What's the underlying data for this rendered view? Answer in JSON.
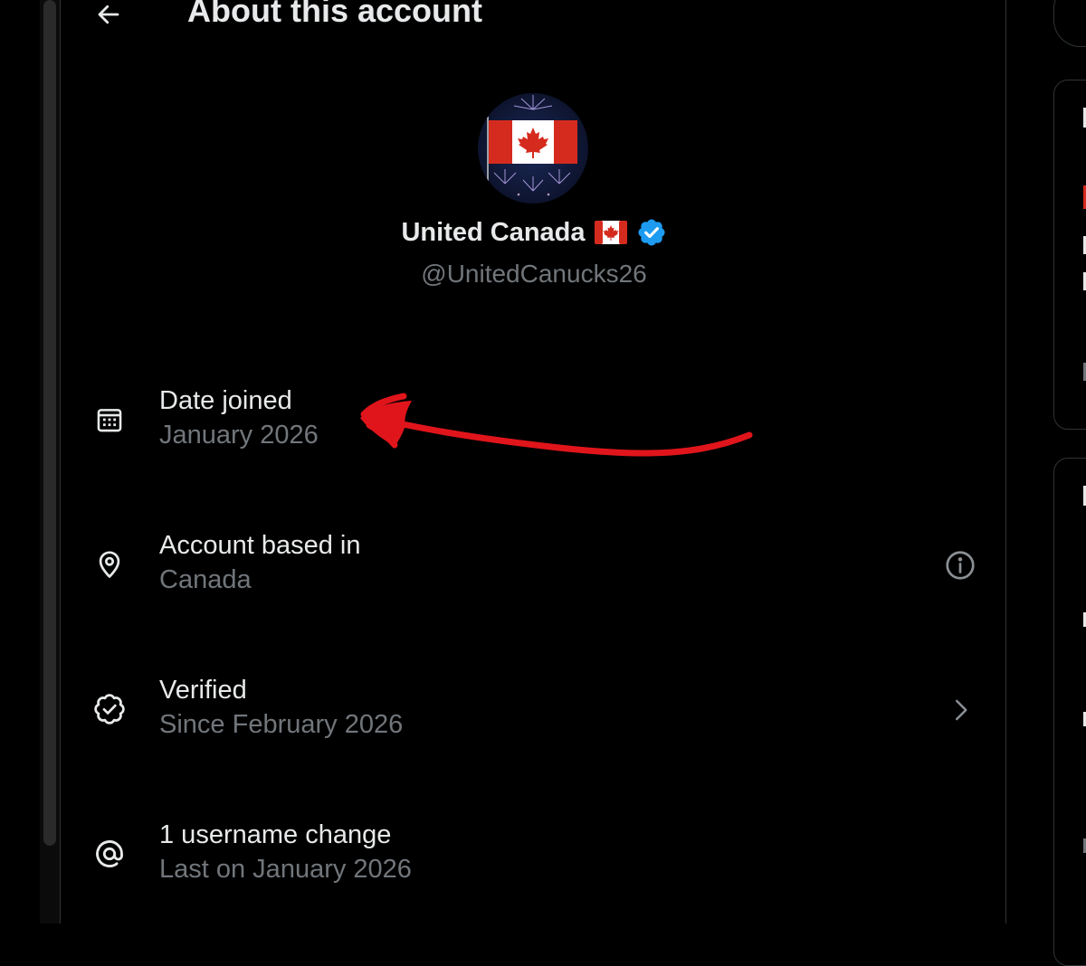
{
  "header": {
    "title": "About this account",
    "back_icon": "arrow-left-icon"
  },
  "profile": {
    "avatar": "canada-flag-fireworks-avatar",
    "display_name": "United Canada",
    "flag_emoji_icon": "canada-flag-emoji-icon",
    "verified_icon": "verified-badge-icon",
    "handle": "@UnitedCanucks26"
  },
  "details": [
    {
      "icon": "calendar-icon",
      "label": "Date joined",
      "value": "January 2026"
    },
    {
      "icon": "location-pin-icon",
      "label": "Account based in",
      "value": "Canada",
      "trailing_icon": "info-icon"
    },
    {
      "icon": "verified-check-icon",
      "label": "Verified",
      "value": "Since February 2026",
      "trailing_icon": "chevron-right-icon"
    },
    {
      "icon": "at-sign-icon",
      "label": "1 username change",
      "value": "Last on January 2026"
    }
  ],
  "colors": {
    "background": "#000000",
    "primary_text": "#e7e9ea",
    "secondary_text": "#71767b",
    "verified_blue": "#1d9bf0",
    "annotation_red": "#e0151b",
    "canada_red": "#d52b1e"
  }
}
